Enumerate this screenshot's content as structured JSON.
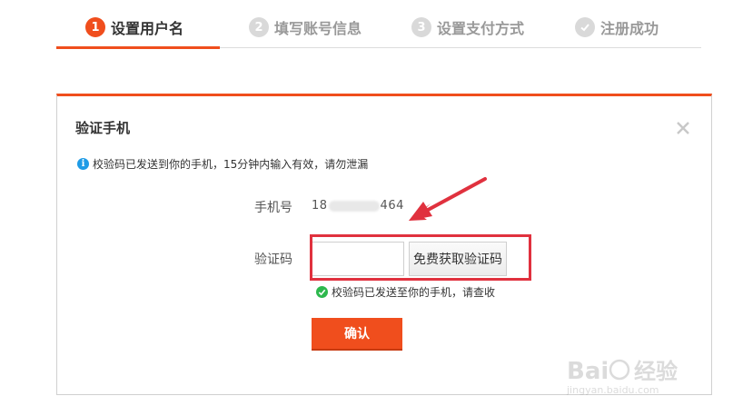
{
  "steps": [
    {
      "num": "1",
      "label": "设置用户名",
      "state": "active"
    },
    {
      "num": "2",
      "label": "填写账号信息",
      "state": "inactive"
    },
    {
      "num": "3",
      "label": "设置支付方式",
      "state": "inactive"
    },
    {
      "num": "",
      "label": "注册成功",
      "state": "inactive",
      "icon": "check-icon"
    }
  ],
  "dialog": {
    "title": "验证手机",
    "info_text": "校验码已发送到你的手机，15分钟内输入有效，请勿泄漏",
    "phone_label": "手机号",
    "phone_prefix": "18",
    "phone_suffix": "464",
    "code_label": "验证码",
    "code_value": "",
    "get_code_label": "免费获取验证码",
    "success_text": "校验码已发送至你的手机，请查收",
    "confirm_label": "确认"
  },
  "colors": {
    "accent": "#f04e1d",
    "annotation": "#e0313e",
    "info": "#1e9be6",
    "success": "#2db84d"
  },
  "watermark": {
    "brand": "Bai 经验",
    "url": "jingyan.baidu.com"
  }
}
